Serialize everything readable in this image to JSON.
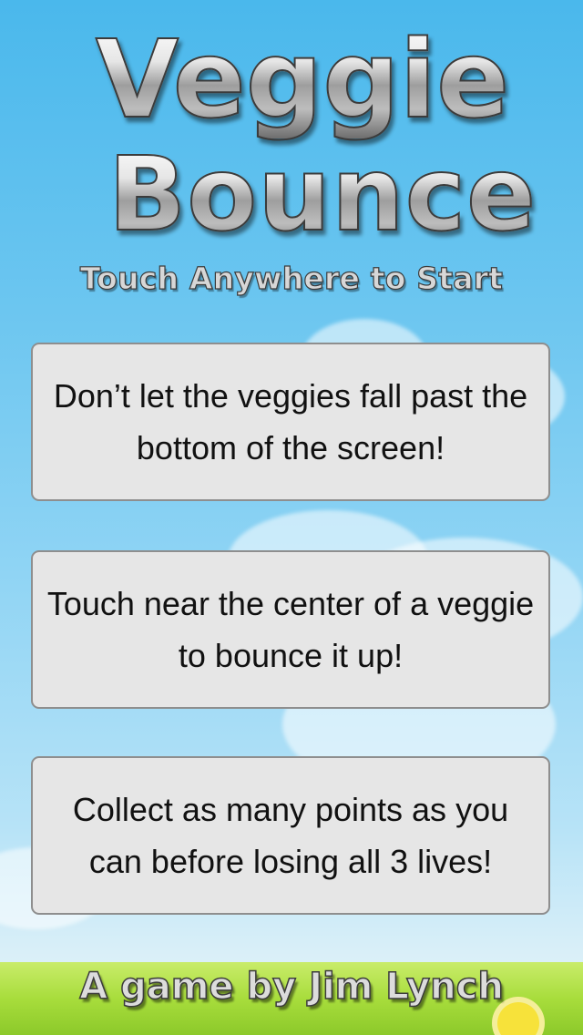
{
  "game": {
    "title_line1": "Veggie",
    "title_line2": "Bounce",
    "start_prompt": "Touch Anywhere to Start",
    "instructions": [
      "Don’t let the veggies fall past the bottom of the screen!",
      "Touch near the center of a veggie to bounce it up!",
      "Collect as many points as you can before losing all 3 lives!"
    ],
    "credit": "A game by Jim Lynch"
  },
  "colors": {
    "sky_top": "#4ab8ec",
    "sky_bottom": "#e8f5f9",
    "card_background": "#e6e6e6",
    "card_border": "#8e8e8e",
    "grass": "#a8dd3c",
    "flower": "#f7e23a"
  }
}
